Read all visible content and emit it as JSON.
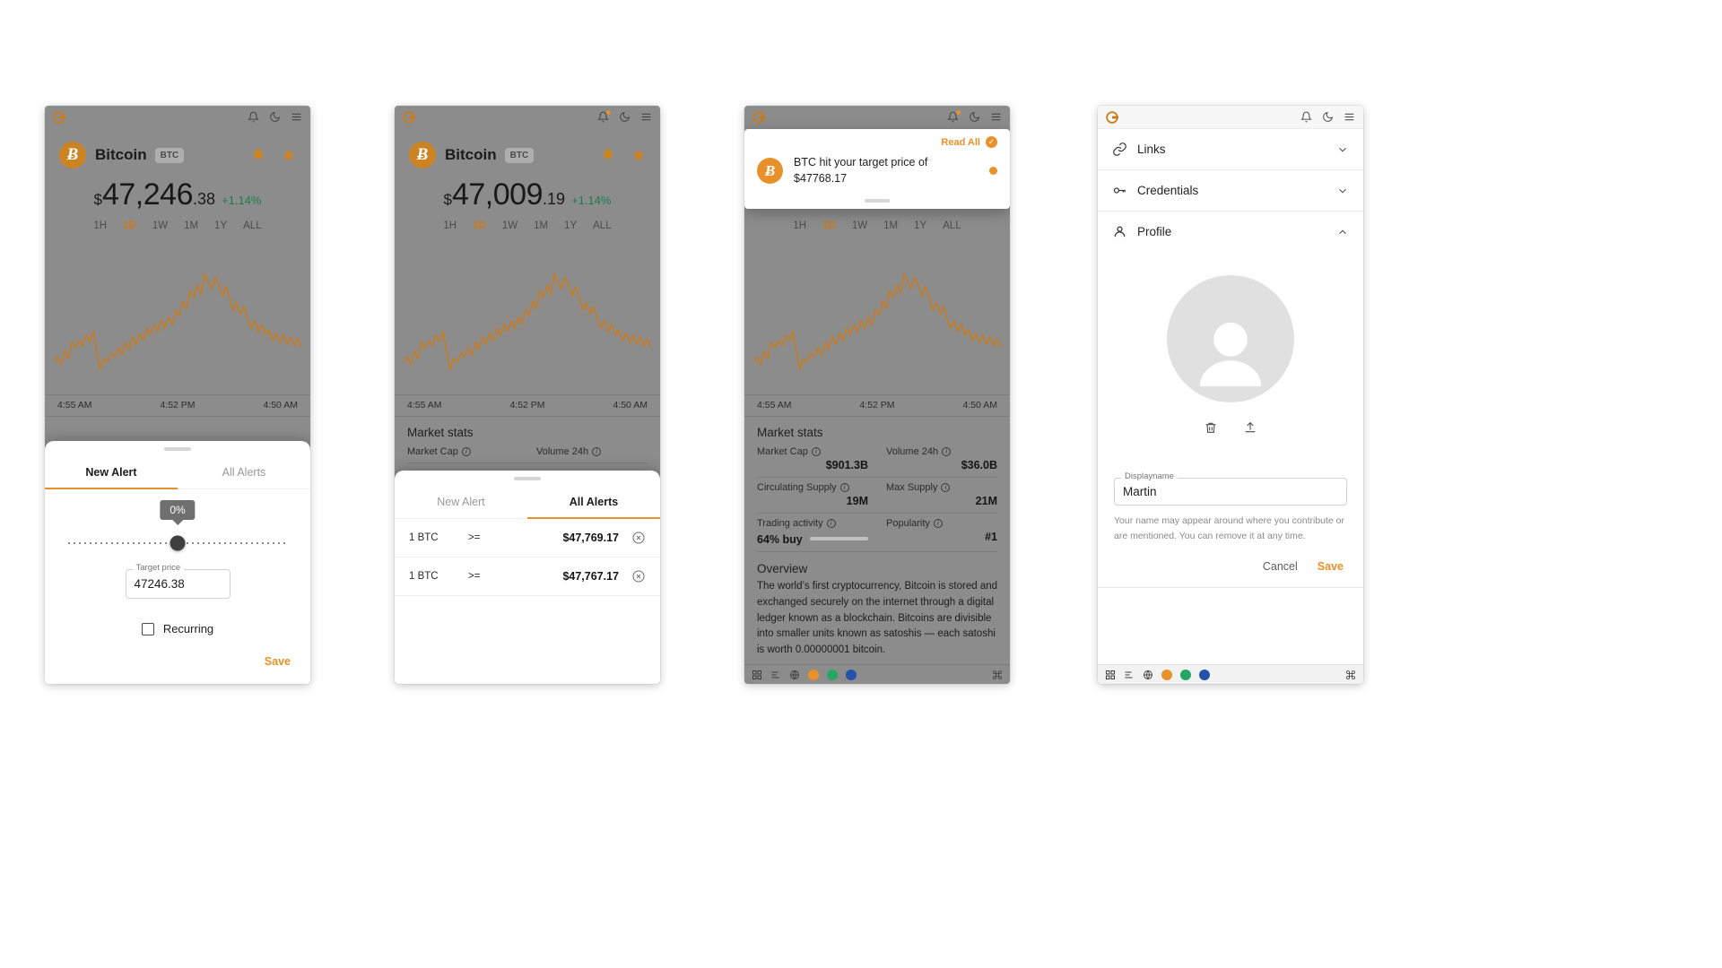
{
  "app": {
    "logo_icon": "coingecko-logo-icon",
    "bell_icon": "bell-icon",
    "moon_icon": "moon-icon",
    "menu_icon": "hamburger-menu-icon",
    "accent": "#E8912B",
    "positive_color": "#1e7d4d",
    "chart_line_color": "#CC7A18"
  },
  "coin": {
    "name": "Bitcoin",
    "ticker": "BTC",
    "symbol_glyph": "Ƀ",
    "currency_sign": "$",
    "price_p1_int": "47,246",
    "price_p1_dec": ".38",
    "price_p2_int": "47,009",
    "price_p2_dec": ".19",
    "change": "+1.14%",
    "bell_icon": "bell-icon",
    "star_icon": "star-icon",
    "ranges": [
      "1H",
      "1D",
      "1W",
      "1M",
      "1Y",
      "ALL"
    ],
    "range_active": "1D",
    "time_axis": [
      "4:55 AM",
      "4:52 PM",
      "4:50 AM"
    ]
  },
  "market_stats": {
    "title": "Market stats",
    "items": [
      {
        "label": "Market Cap",
        "value": "$901.3B",
        "info_icon": "info-icon"
      },
      {
        "label": "Volume 24h",
        "value": "$36.0B",
        "info_icon": "info-icon"
      },
      {
        "label": "Circulating Supply",
        "value": "19M",
        "info_icon": "info-icon"
      },
      {
        "label": "Max Supply",
        "value": "21M",
        "info_icon": "info-icon"
      },
      {
        "label": "Trading activity",
        "value": "64% buy",
        "info_icon": "info-icon",
        "bar_percent": 64
      },
      {
        "label": "Popularity",
        "value": "#1",
        "info_icon": "info-icon"
      }
    ]
  },
  "overview": {
    "title": "Overview",
    "body": "The world’s first cryptocurrency, Bitcoin is stored and exchanged securely on the internet through a digital ledger known as a blockchain. Bitcoins are divisible into smaller units known as satoshis — each satoshi is worth 0.00000001 bitcoin."
  },
  "alert_sheet": {
    "tabs": [
      {
        "label": "New Alert"
      },
      {
        "label": "All Alerts"
      }
    ],
    "active_tab_panel1": "New Alert",
    "active_tab_panel2": "All Alerts",
    "slider_bubble": "0%",
    "target_price_label": "Target price",
    "target_price_value": "47246.38",
    "recurring_label": "Recurring",
    "recurring_checked": false,
    "save_label": "Save",
    "alerts": [
      {
        "amount": "1 BTC",
        "operator": ">=",
        "price": "$47,769.17",
        "remove_icon": "remove-circle-icon"
      },
      {
        "amount": "1 BTC",
        "operator": ">=",
        "price": "$47,767.17",
        "remove_icon": "remove-circle-icon"
      }
    ]
  },
  "toast": {
    "read_all_label": "Read All",
    "check_icon": "check-circle-icon",
    "coin_icon": "bitcoin-icon",
    "message": "BTC hit your target price of $47768.17",
    "unread_dot": true
  },
  "settings": {
    "rows": [
      {
        "label": "Links",
        "icon": "link-icon",
        "chevron": "chevron-down-icon",
        "expanded": false
      },
      {
        "label": "Credentials",
        "icon": "key-icon",
        "chevron": "chevron-down-icon",
        "expanded": false
      },
      {
        "label": "Profile",
        "icon": "person-icon",
        "chevron": "chevron-up-icon",
        "expanded": true
      }
    ],
    "avatar_icon": "default-avatar-icon",
    "delete_icon": "trash-icon",
    "upload_icon": "upload-icon",
    "displayname_label": "Displayname",
    "displayname_value": "Martin",
    "help_text": "Your name may appear around where you contribute or are mentioned. You can remove it at any time.",
    "cancel_label": "Cancel",
    "save_label": "Save"
  },
  "dock": {
    "icons": [
      "apps-grid-icon",
      "list-icon",
      "globe-icon",
      "bitcoin-coin-icon",
      "ethereum-coin-icon",
      "coin-blue-icon"
    ],
    "command_icon": "command-key-icon"
  }
}
